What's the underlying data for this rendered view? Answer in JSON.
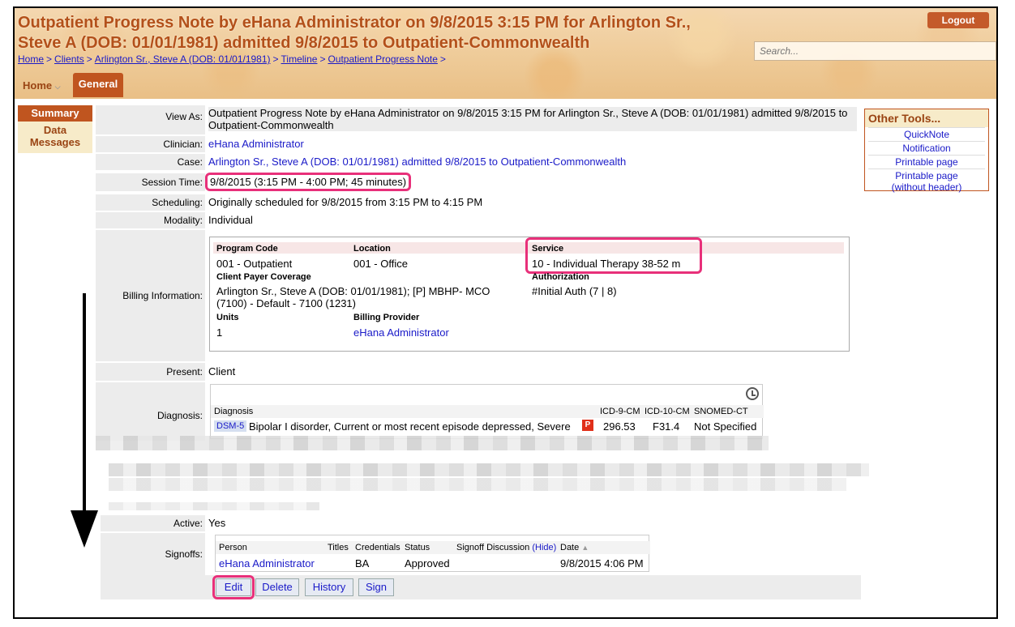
{
  "header": {
    "title_line1": "Outpatient Progress Note by eHana Administrator on 9/8/2015 3:15 PM for Arlington Sr.,",
    "title_line2": "Steve A (DOB: 01/01/1981) admitted 9/8/2015 to Outpatient-Commonwealth",
    "breadcrumb": [
      "Home",
      "Clients",
      "Arlington Sr., Steve A (DOB: 01/01/1981)",
      "Timeline",
      "Outpatient Progress Note"
    ],
    "breadcrumb_sep": ">",
    "logout_label": "Logout",
    "search_placeholder": "Search...",
    "nav_home": "Home",
    "nav_general": "General"
  },
  "subnav": {
    "summary": "Summary",
    "data_messages": "Data Messages"
  },
  "note": {
    "view_as_label": "View As:",
    "view_as_value": "Outpatient Progress Note by eHana Administrator on 9/8/2015 3:15 PM for Arlington Sr., Steve A (DOB: 01/01/1981) admitted 9/8/2015 to Outpatient-Commonwealth",
    "clinician_label": "Clinician:",
    "clinician_value": "eHana Administrator",
    "case_label": "Case:",
    "case_value": "Arlington Sr., Steve A (DOB: 01/01/1981) admitted 9/8/2015 to Outpatient-Commonwealth",
    "session_time_label": "Session Time:",
    "session_time_value": "9/8/2015 (3:15 PM - 4:00 PM; 45 minutes)",
    "scheduling_label": "Scheduling:",
    "scheduling_value": "Originally scheduled for 9/8/2015 from 3:15 PM to 4:15 PM",
    "modality_label": "Modality:",
    "modality_value": "Individual",
    "billing_label": "Billing Information:",
    "present_label": "Present:",
    "present_value": "Client",
    "diagnosis_label": "Diagnosis:",
    "active_label": "Active:",
    "active_value": "Yes",
    "signoffs_label": "Signoffs:"
  },
  "billing": {
    "program_code_h": "Program Code",
    "program_code": "001 - Outpatient",
    "location_h": "Location",
    "location": "001 - Office",
    "service_h": "Service",
    "service": "10 - Individual Therapy 38-52 m",
    "payer_h": "Client Payer Coverage",
    "payer": "Arlington Sr., Steve A (DOB: 01/01/1981); [P] MBHP- MCO (7100) - Default - 7100 (1231)",
    "authorization_h": "Authorization",
    "authorization": "#Initial Auth (7 | 8)",
    "units_h": "Units",
    "units": "1",
    "billing_provider_h": "Billing Provider",
    "billing_provider": "eHana Administrator"
  },
  "diagnosis": {
    "headers": [
      "Diagnosis",
      "ICD-9-CM",
      "ICD-10-CM",
      "SNOMED-CT"
    ],
    "tag": "DSM-5",
    "name": "Bipolar I disorder, Current or most recent episode depressed, Severe",
    "badge": "P",
    "icd9": "296.53",
    "icd10": "F31.4",
    "snomed": "Not Specified"
  },
  "signoffs": {
    "headers": {
      "person": "Person",
      "titles": "Titles",
      "credentials": "Credentials",
      "status": "Status",
      "discussion": "Signoff Discussion",
      "hide": "(Hide)",
      "date": "Date"
    },
    "row": {
      "person": "eHana Administrator",
      "credentials": "BA",
      "status": "Approved",
      "date": "9/8/2015 4:06 PM"
    }
  },
  "actions": {
    "edit": "Edit",
    "delete": "Delete",
    "history": "History",
    "sign": "Sign"
  },
  "other_tools": {
    "title": "Other Tools...",
    "links": [
      "QuickNote",
      "Notification",
      "Printable page",
      "Printable page",
      "(without header)"
    ]
  },
  "colors": {
    "accent": "#c0551f",
    "highlight": "#e8307a",
    "link": "#1a1ac8"
  }
}
